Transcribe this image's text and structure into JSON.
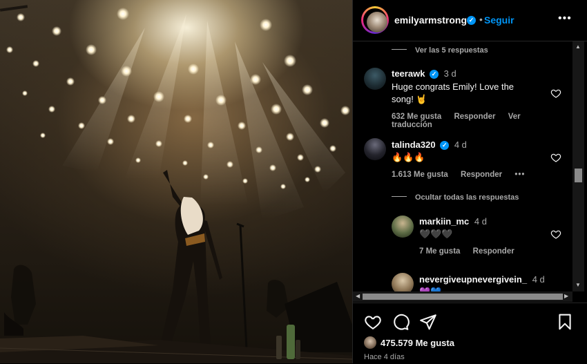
{
  "post": {
    "author": "emilyarmstrong",
    "verified_mark": "✓",
    "separator": "•",
    "follow_label": "Seguir",
    "more_label": "•••",
    "likes_label": "475.579 Me gusta",
    "time_ago": "Hace 4 días"
  },
  "comments": {
    "view_replies_1": "Ver las 5 respuestas",
    "items": [
      {
        "user": "teerawk",
        "time": "3 d",
        "text_line1": "Huge congrats Emily! Love the",
        "text_line2": "song! 🤘",
        "likes": "632 Me gusta",
        "reply": "Responder",
        "translate": "Ver traducción"
      },
      {
        "user": "talinda320",
        "time": "4 d",
        "text_line1": "🔥🔥🔥",
        "likes": "1.613 Me gusta",
        "reply": "Responder",
        "more": "•••"
      }
    ],
    "hide_replies": "Ocultar todas las respuestas",
    "replies": [
      {
        "user": "markiin_mc",
        "time": "4 d",
        "text_line1": "🖤🖤🖤",
        "likes": "7 Me gusta",
        "reply": "Responder"
      },
      {
        "user": "nevergiveupnevergivein_",
        "time": "4 d",
        "text_line1": "💜💙"
      }
    ]
  },
  "icons": {
    "like": "heart-icon",
    "comment": "comment-icon",
    "share": "send-icon",
    "save": "bookmark-icon"
  },
  "colors": {
    "accent": "#0095f6",
    "secondary_text": "#a8a8a8",
    "background": "#000000"
  }
}
